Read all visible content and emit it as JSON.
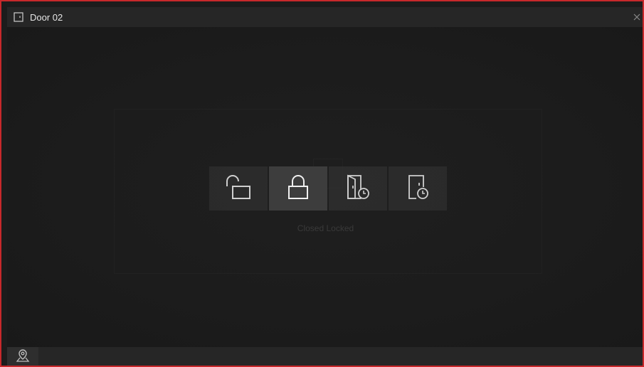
{
  "window": {
    "title": "Door 02",
    "border_color": "#c8282b"
  },
  "titlebar": {
    "icon": "door-icon",
    "close_icon": "close-icon"
  },
  "controls": [
    {
      "name": "open-door-button",
      "icon": "unlock-icon",
      "active": false
    },
    {
      "name": "close-door-button",
      "icon": "lock-icon",
      "active": true
    },
    {
      "name": "remain-open-button",
      "icon": "door-open-clock-icon",
      "active": false
    },
    {
      "name": "remain-closed-button",
      "icon": "door-closed-clock-icon",
      "active": false
    }
  ],
  "status": {
    "text": "Closed Locked"
  },
  "footer": {
    "map_icon": "map-pin-icon"
  }
}
